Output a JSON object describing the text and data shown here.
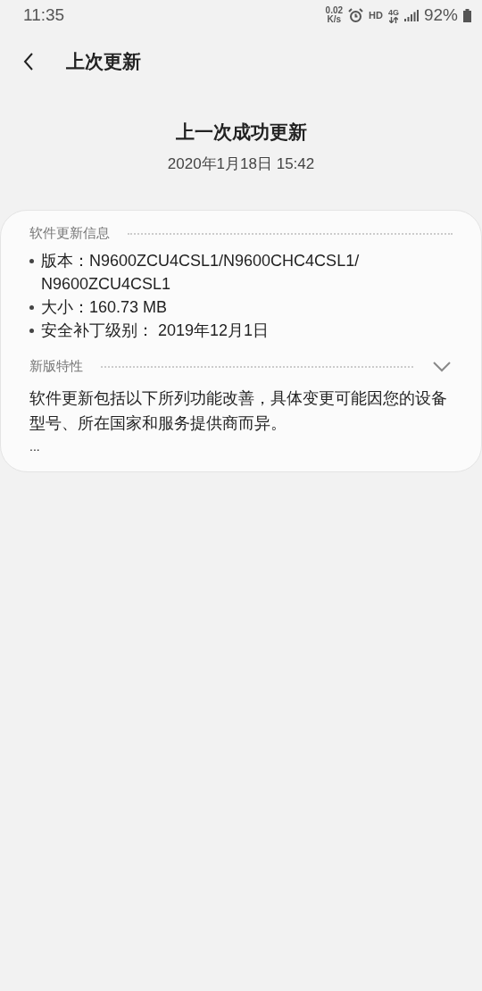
{
  "status_bar": {
    "time": "11:35",
    "net_speed": "0.02",
    "net_unit": "K/s",
    "hd": "HD",
    "network": "4G",
    "battery": "92%"
  },
  "header": {
    "title": "上次更新"
  },
  "last_update": {
    "heading": "上一次成功更新",
    "date": "2020年1月18日 15:42"
  },
  "info": {
    "title": "软件更新信息",
    "items": [
      "版本：N9600ZCU4CSL1/N9600CHC4CSL1/N9600ZCU4CSL1",
      "大小：160.73 MB",
      "安全补丁级别： 2019年12月1日"
    ]
  },
  "features": {
    "title": "新版特性",
    "expanded": false,
    "text": "软件更新包括以下所列功能改善，具体变更可能因您的设备型号、所在国家和服务提供商而异。",
    "more": "..."
  }
}
